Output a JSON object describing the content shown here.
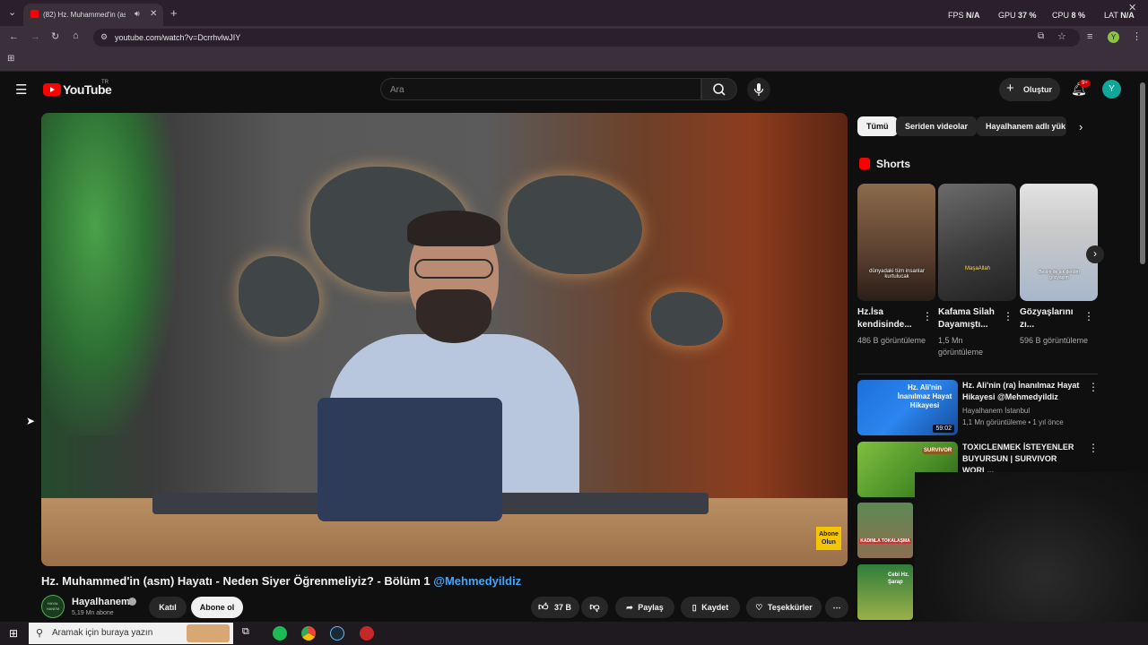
{
  "browser": {
    "tab_title": "(82) Hz. Muhammed'in (asm",
    "url": "youtube.com/watch?v=DcrrhvlwJIY",
    "perf": {
      "fps_label": "FPS",
      "fps_value": "N/A",
      "gpu_label": "GPU",
      "gpu_value": "37 %",
      "cpu_label": "CPU",
      "cpu_value": "8 %",
      "lat_label": "LAT",
      "lat_value": "N/A"
    }
  },
  "youtube": {
    "logo_text": "YouTube",
    "region": "TR",
    "search_placeholder": "Ara",
    "create_label": "Oluştur",
    "notif_badge": "9+",
    "avatar_letter": "Y"
  },
  "video": {
    "title": "Hz. Muhammed'in (asm) Hayatı - Neden Siyer Öğrenmeliyiz? - Bölüm 1",
    "title_handle": "@Mehmedyildiz",
    "overlay_tag": "Abone Olun",
    "channel_avatar_text": "HAYAL HANEM",
    "channel_name": "Hayalhanem",
    "subscribers": "5,19 Mn abone",
    "join_label": "Katıl",
    "subscribe_label": "Abone ol",
    "likes": "37 B",
    "share_label": "Paylaş",
    "save_label": "Kaydet",
    "thanks_label": "Teşekkürler"
  },
  "sidebar": {
    "chips": [
      "Tümü",
      "Seriden videolar",
      "Hayalhanem adlı yük"
    ],
    "shorts_heading": "Shorts",
    "shorts": [
      {
        "title": "Hz.İsa kendisinde...",
        "views": "486 B görüntüleme",
        "caption": "dünyadaki tüm insanlar kurtulucak"
      },
      {
        "title": "Kafama Silah Dayamıştı...",
        "views": "1,5 Mn görüntüleme",
        "caption": "MaşaAllah"
      },
      {
        "title": "Gözyaşlarını zı...",
        "views": "596 B görüntüleme",
        "caption": "Benim de sık derdim gözyaşım"
      }
    ],
    "related": [
      {
        "title": "Hz. Ali'nin (ra) İnanılmaz Hayat Hikayesi @Mehmedyildiz",
        "channel": "Hayalhanem İstanbul",
        "meta": "1,1 Mn görüntüleme • 1 yıl önce",
        "duration": "59:02",
        "thumb_text": "Hz. Ali'nin İnanılmaz Hayat Hikayesi"
      },
      {
        "title": "TOXICLENMEK İSTEYENLER BUYURSUN | SURVIVOR WORL...",
        "thumb_text": "SURVIVOR"
      }
    ],
    "small_thumbs": [
      "KADINLA TOKALAŞMA",
      "Cebi Hz. Şarap"
    ]
  },
  "taskbar": {
    "search_placeholder": "Aramak için buraya yazın"
  }
}
